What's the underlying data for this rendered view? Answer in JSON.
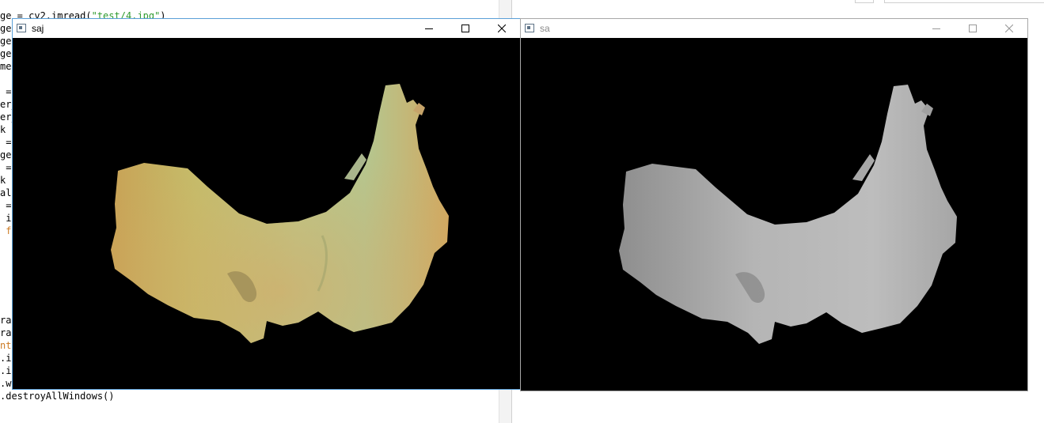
{
  "editor": {
    "code_lines": [
      {
        "pre": "ge = cv2.imread(",
        "str": "\"test/4.jpg\"",
        "post": ")",
        "kw": ""
      },
      {
        "pre": "ge",
        "str": "",
        "post": "",
        "kw": ""
      },
      {
        "pre": "ge",
        "str": "",
        "post": "",
        "kw": ""
      },
      {
        "pre": "ge",
        "str": "",
        "post": "",
        "kw": ""
      },
      {
        "pre": "me",
        "str": "",
        "post": "",
        "kw": ""
      },
      {
        "pre": "",
        "str": "",
        "post": "",
        "kw": ""
      },
      {
        "pre": " =",
        "str": "",
        "post": "",
        "kw": ""
      },
      {
        "pre": "er_",
        "str": "",
        "post": "",
        "kw": ""
      },
      {
        "pre": "er_",
        "str": "",
        "post": "",
        "kw": ""
      },
      {
        "pre": "k =",
        "str": "",
        "post": "",
        "kw": ""
      },
      {
        "pre": " =",
        "str": "",
        "post": "",
        "kw": ""
      },
      {
        "pre": "ge",
        "str": "",
        "post": "",
        "kw": ""
      },
      {
        "pre": " =",
        "str": "",
        "post": "",
        "kw": ""
      },
      {
        "pre": "k =",
        "str": "",
        "post": "",
        "kw": ""
      },
      {
        "pre": "al",
        "str": "",
        "post": "",
        "kw": ""
      },
      {
        "pre": " =",
        "str": "",
        "post": "",
        "kw": ""
      },
      {
        "pre": " i",
        "str": "",
        "post": "",
        "kw": ""
      },
      {
        "pre": " ",
        "str": "",
        "post": "",
        "kw": "fc"
      }
    ],
    "code_lines_bottom": [
      {
        "pre": "rag",
        "kw": ""
      },
      {
        "pre": "rag",
        "kw": ""
      },
      {
        "pre": "",
        "kw": "nt"
      },
      {
        "pre": ".in",
        "kw": ""
      },
      {
        "pre": ".in",
        "kw": ""
      },
      {
        "pre": ".wa",
        "kw": ""
      },
      {
        "pre": ".destroyAllWindows()",
        "kw": ""
      }
    ]
  },
  "windows": [
    {
      "id": "saj",
      "title": "saj",
      "active": true,
      "image": "color-mask-image"
    },
    {
      "id": "sa",
      "title": "sa",
      "active": false,
      "image": "grayscale-mask-image"
    }
  ],
  "controls": {
    "minimize": "minimize-icon",
    "maximize": "maximize-icon",
    "close": "close-icon"
  },
  "colors": {
    "accent_border": "#5aa0d8",
    "inactive_border": "#a8a8a8",
    "string": "#2e9a2e",
    "keyword": "#cc7a22"
  }
}
